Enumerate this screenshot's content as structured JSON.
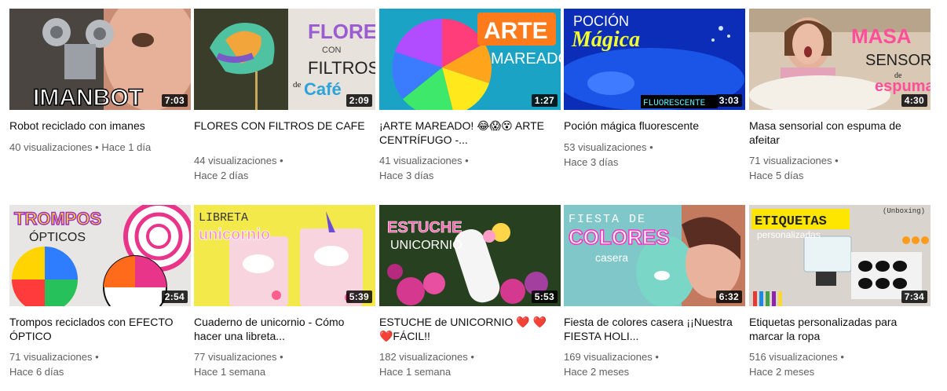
{
  "videos": [
    {
      "title": "Robot reciclado con imanes",
      "views": "40 visualizaciones",
      "age": "Hace 1 día",
      "duration": "7:03",
      "thumb_text": [
        "IMANBOT"
      ]
    },
    {
      "title": "FLORES CON FILTROS DE CAFE",
      "views": "44 visualizaciones",
      "age": "Hace 2 días",
      "duration": "2:09",
      "thumb_text": [
        "FLORES",
        "CON",
        "FILTROS",
        "de",
        "Café"
      ]
    },
    {
      "title": "¡ARTE MAREADO! 😂😱😵 ARTE CENTRÍFUGO -...",
      "views": "41 visualizaciones",
      "age": "Hace 3 días",
      "duration": "1:27",
      "thumb_text": [
        "ARTE",
        "MAREADO"
      ]
    },
    {
      "title": "Poción mágica fluorescente",
      "views": "53 visualizaciones",
      "age": "Hace 3 días",
      "duration": "3:03",
      "thumb_text": [
        "POCIÓN",
        "Mágica",
        "FLUORESCENTE"
      ]
    },
    {
      "title": "Masa sensorial con espuma de afeitar",
      "views": "71 visualizaciones",
      "age": "Hace 5 días",
      "duration": "4:30",
      "thumb_text": [
        "MASA",
        "SENSORIAL",
        "de",
        "espuma"
      ]
    },
    {
      "title": "Trompos reciclados con EFECTO ÓPTICO",
      "views": "71 visualizaciones",
      "age": "Hace 6 días",
      "duration": "2:54",
      "thumb_text": [
        "TROMPOS",
        "ÓPTICOS"
      ]
    },
    {
      "title": "Cuaderno de unicornio - Cómo hacer una libreta...",
      "views": "77 visualizaciones",
      "age": "Hace 1 semana",
      "duration": "5:39",
      "thumb_text": [
        "LIBRETA",
        "unicornio"
      ]
    },
    {
      "title": "ESTUCHE de UNICORNIO ❤️ ❤️ ❤️FÁCIL!!",
      "views": "182 visualizaciones",
      "age": "Hace 1 semana",
      "duration": "5:53",
      "thumb_text": [
        "ESTUCHE",
        "UNICORNIO"
      ]
    },
    {
      "title": "Fiesta de colores casera ¡¡Nuestra FIESTA HOLI...",
      "views": "169 visualizaciones",
      "age": "Hace 2 meses",
      "duration": "6:32",
      "thumb_text": [
        "FIESTA DE",
        "COLORES",
        "casera"
      ]
    },
    {
      "title": "Etiquetas personalizadas para marcar la ropa",
      "views": "516 visualizaciones",
      "age": "Hace 2 meses",
      "duration": "7:34",
      "thumb_text": [
        "ETIQUETAS",
        "personalizadas",
        "(Unboxing)"
      ]
    }
  ],
  "meta_separator": "•"
}
